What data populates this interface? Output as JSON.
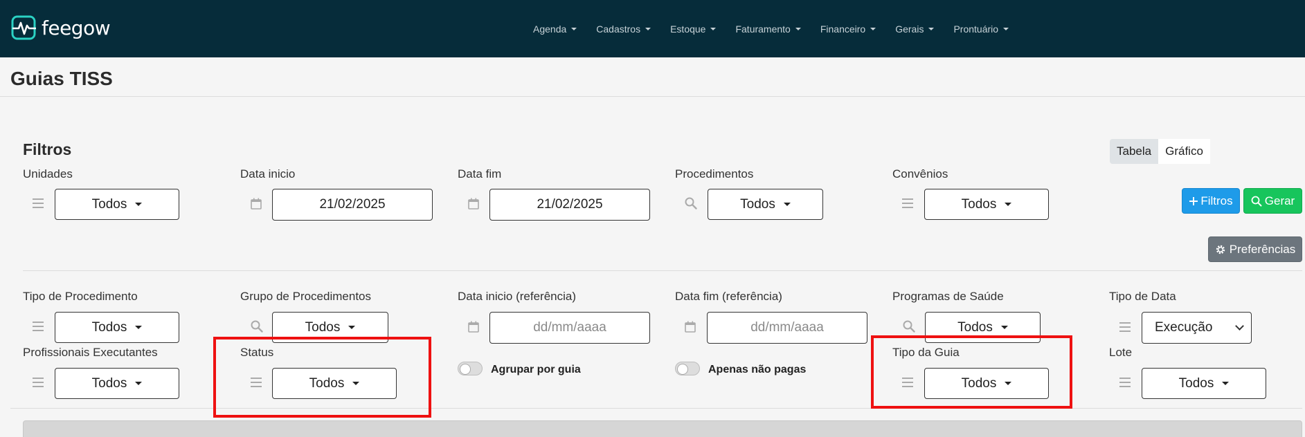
{
  "app": {
    "name": "feegow"
  },
  "nav": {
    "items": [
      "Agenda",
      "Cadastros",
      "Estoque",
      "Faturamento",
      "Financeiro",
      "Gerais",
      "Prontuário"
    ]
  },
  "page": {
    "title": "Guias TISS"
  },
  "filters": {
    "title": "Filtros",
    "unidades": {
      "label": "Unidades",
      "value": "Todos"
    },
    "data_inicio": {
      "label": "Data inicio",
      "value": "21/02/2025"
    },
    "data_fim": {
      "label": "Data fim",
      "value": "21/02/2025"
    },
    "procedimentos": {
      "label": "Procedimentos",
      "value": "Todos"
    },
    "convenios": {
      "label": "Convênios",
      "value": "Todos"
    },
    "tipo_procedimento": {
      "label": "Tipo de Procedimento",
      "value": "Todos"
    },
    "grupo_procedimentos": {
      "label": "Grupo de Procedimentos",
      "value": "Todos"
    },
    "data_inicio_ref": {
      "label": "Data inicio (referência)",
      "placeholder": "dd/mm/aaaa"
    },
    "data_fim_ref": {
      "label": "Data fim (referência)",
      "placeholder": "dd/mm/aaaa"
    },
    "programas_saude": {
      "label": "Programas de Saúde",
      "value": "Todos"
    },
    "tipo_data": {
      "label": "Tipo de Data",
      "value": "Execução"
    },
    "profissionais": {
      "label": "Profissionais Executantes",
      "value": "Todos"
    },
    "status": {
      "label": "Status",
      "value": "Todos"
    },
    "agrupar_guia": {
      "label": "Agrupar por guia"
    },
    "apenas_nao_pagas": {
      "label": "Apenas não pagas"
    },
    "tipo_guia": {
      "label": "Tipo da Guia",
      "value": "Todos"
    },
    "lote": {
      "label": "Lote",
      "value": "Todos"
    }
  },
  "view_toggle": {
    "tabela": "Tabela",
    "grafico": "Gráfico"
  },
  "buttons": {
    "filtros": "Filtros",
    "gerar": "Gerar",
    "preferencias": "Preferências"
  },
  "colors": {
    "navbar": "#062c3a",
    "primary": "#1e9be9",
    "success": "#17c55c",
    "secondary": "#6c757d",
    "highlight": "#ee1111"
  }
}
